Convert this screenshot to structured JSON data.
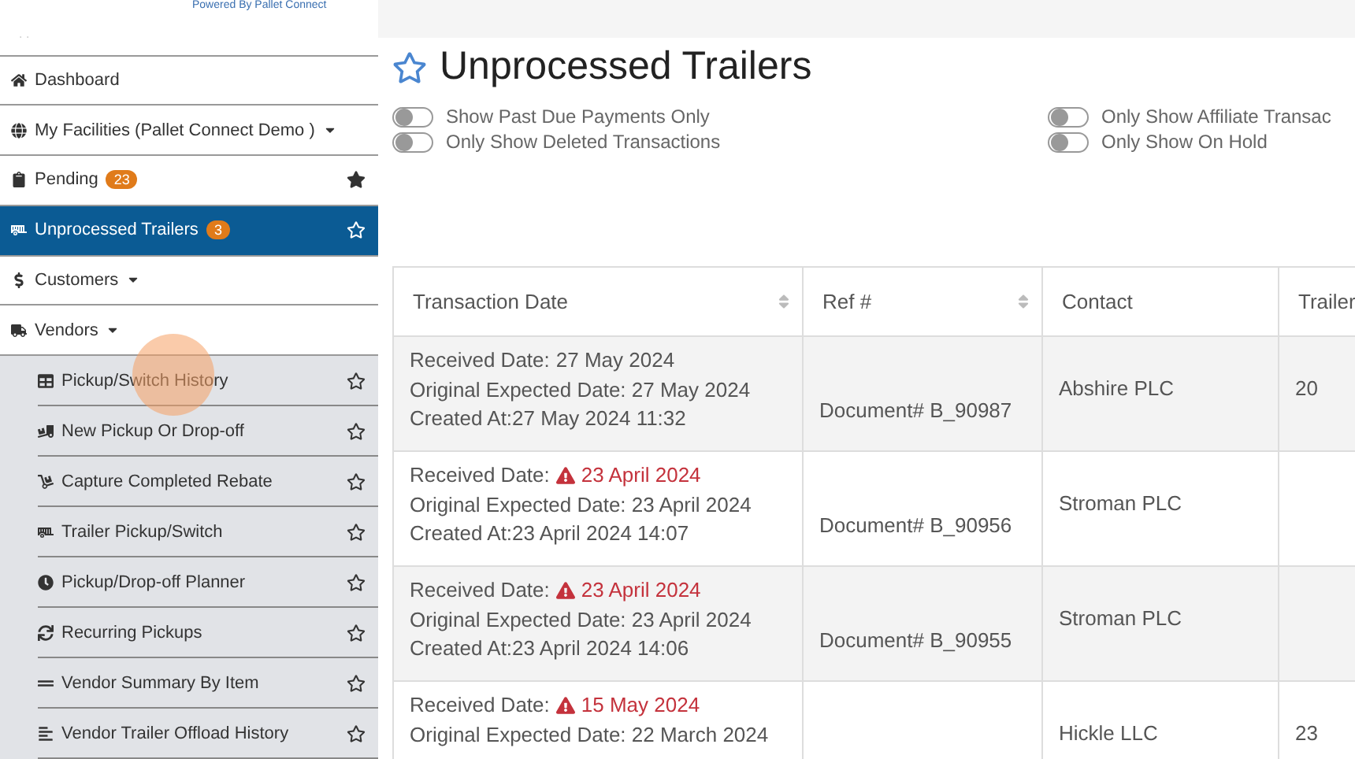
{
  "brand": {
    "tagline": "Powered By Pallet Connect",
    "dots": ". ."
  },
  "sidebar": {
    "items": [
      {
        "label": "Dashboard",
        "kind": "top",
        "selected": false
      },
      {
        "label": "My Facilities  (Pallet Connect Demo )",
        "kind": "top",
        "selected": false,
        "dropdown": true
      },
      {
        "label": "Pending",
        "kind": "top",
        "selected": false,
        "badge": "23",
        "starred": true
      },
      {
        "label": "Unprocessed Trailers",
        "kind": "top",
        "selected": true,
        "badge": "3",
        "starred": false
      },
      {
        "label": "Customers",
        "kind": "top",
        "selected": false,
        "dropdown": true
      },
      {
        "label": "Vendors",
        "kind": "top",
        "selected": false,
        "dropdown": true
      },
      {
        "label": "Pickup/Switch History",
        "kind": "sub",
        "selected": false,
        "starred": false
      },
      {
        "label": "New Pickup Or Drop-off",
        "kind": "sub",
        "selected": false,
        "starred": false
      },
      {
        "label": "Capture Completed Rebate",
        "kind": "sub",
        "selected": false,
        "starred": false
      },
      {
        "label": "Trailer Pickup/Switch",
        "kind": "sub",
        "selected": false,
        "starred": false
      },
      {
        "label": "Pickup/Drop-off Planner",
        "kind": "sub",
        "selected": false,
        "starred": false
      },
      {
        "label": "Recurring Pickups",
        "kind": "sub",
        "selected": false,
        "starred": false
      },
      {
        "label": "Vendor Summary By Item",
        "kind": "sub",
        "selected": false,
        "starred": false
      },
      {
        "label": "Vendor Trailer Offload History",
        "kind": "sub",
        "selected": false,
        "starred": false
      }
    ]
  },
  "page": {
    "title": "Unprocessed Trailers",
    "starred": false
  },
  "toggles": [
    {
      "label": "Show Past Due Payments Only",
      "on": false
    },
    {
      "label": "Only Show Affiliate Transac",
      "on": false
    },
    {
      "label": "Only Show Deleted Transactions",
      "on": false
    },
    {
      "label": "Only Show On Hold",
      "on": false
    }
  ],
  "table": {
    "columns": [
      {
        "label": "Transaction Date",
        "sortable": true
      },
      {
        "label": "Ref #",
        "sortable": true
      },
      {
        "label": "Contact",
        "sortable": false
      },
      {
        "label": "Trailer",
        "sortable": false
      }
    ],
    "rows": [
      {
        "received_label": "Received Date:",
        "received": "27 May 2024",
        "overdue": false,
        "expected": "Original Expected Date:  27 May 2024",
        "created": "Created At:27 May 2024 11:32",
        "ref": "Document# B_90987",
        "contact": "Abshire PLC",
        "trailer": "20"
      },
      {
        "received_label": "Received Date:",
        "received": "23 April 2024",
        "overdue": true,
        "expected": "Original Expected Date:  23 April 2024",
        "created": "Created At:23 April 2024 14:07",
        "ref": "Document# B_90956",
        "contact": "Stroman PLC"
      },
      {
        "received_label": "Received Date:",
        "received": "23 April 2024",
        "overdue": true,
        "expected": "Original Expected Date:  23 April 2024",
        "created": "Created At:23 April 2024 14:06",
        "ref": "Document# B_90955",
        "contact": "Stroman PLC"
      },
      {
        "received_label": "Received Date:",
        "received": "15 May 2024",
        "overdue": true,
        "expected": "Original Expected Date:  22 March 2024",
        "contact": "Hickle LLC",
        "trailer": "23"
      }
    ]
  }
}
